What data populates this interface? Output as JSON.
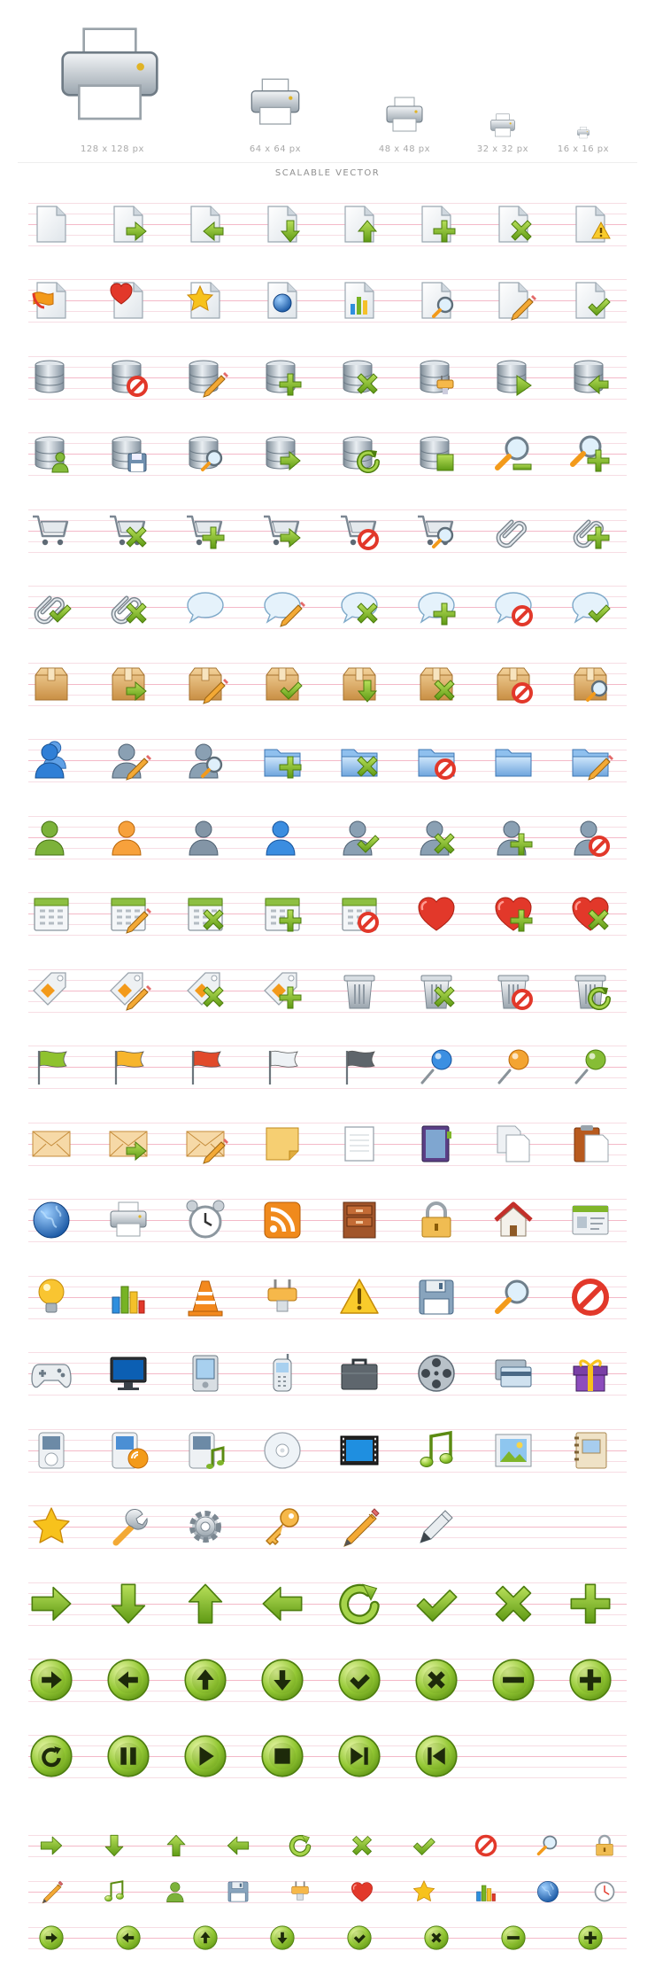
{
  "header": {
    "sizes": [
      "128 x 128 px",
      "64 x 64 px",
      "48 x 48 px",
      "32 x 32 px",
      "16 x 16 px"
    ],
    "title": "SCALABLE VECTOR"
  },
  "colors": {
    "green": "#77b324",
    "green_dark": "#4f7f10",
    "red": "#e23a2a",
    "orange": "#f39a1a",
    "blue": "#2d76c7",
    "gray": "#8c9aa6",
    "paper": "#eef1f4",
    "guide_line": "#f6c6d2"
  },
  "rows": [
    [
      "page",
      "page-arrow-right",
      "page-arrow-left",
      "page-arrow-down",
      "page-arrow-up",
      "page-add",
      "page-delete",
      "page-warning"
    ],
    [
      "page-bookmark",
      "page-heart",
      "page-star",
      "page-globe",
      "page-chart",
      "page-search",
      "page-edit",
      "page-check"
    ],
    [
      "database",
      "database-block",
      "database-edit",
      "database-add",
      "database-delete",
      "database-plug",
      "database-play",
      "database-import"
    ],
    [
      "database-user",
      "database-save",
      "database-search",
      "database-export",
      "database-refresh",
      "database-stop",
      "zoom-out",
      "zoom-in"
    ],
    [
      "cart",
      "cart-delete",
      "cart-add",
      "cart-go",
      "cart-block",
      "cart-search",
      "attach",
      "attach-add"
    ],
    [
      "attach-check",
      "attach-delete",
      "comment",
      "comment-edit",
      "comment-delete",
      "comment-add",
      "comment-block",
      "comment-check"
    ],
    [
      "box",
      "box-go",
      "box-edit",
      "box-check",
      "box-down",
      "box-delete",
      "box-block",
      "box-search"
    ],
    [
      "users",
      "user-edit",
      "user-search",
      "folder-add",
      "folder-delete",
      "folder-block",
      "folder",
      "folder-edit"
    ],
    [
      "user-green",
      "user-orange",
      "user-gray",
      "user-blue",
      "user-check",
      "user-delete",
      "user-add",
      "user-block"
    ],
    [
      "calendar",
      "calendar-edit",
      "calendar-delete",
      "calendar-add",
      "calendar-block",
      "heart",
      "heart-add",
      "heart-delete"
    ],
    [
      "tag",
      "tag-edit",
      "tag-delete",
      "tag-add",
      "trash",
      "trash-delete",
      "trash-block",
      "trash-refresh"
    ],
    [
      "flag-green",
      "flag-yellow",
      "flag-red",
      "flag-white",
      "flag-black",
      "pin-blue",
      "pin-orange",
      "pin-green"
    ],
    [
      "mail",
      "mail-go",
      "mail-edit",
      "note",
      "notepad",
      "book",
      "pages",
      "clipboard"
    ],
    [
      "globe",
      "printer",
      "alarm-clock",
      "rss",
      "cabinet",
      "lock",
      "home",
      "id-card"
    ],
    [
      "bulb",
      "chart",
      "cone",
      "plug",
      "warning",
      "disk",
      "search",
      "block"
    ],
    [
      "gamepad",
      "monitor",
      "pda",
      "phone",
      "briefcase",
      "film-reel",
      "credit-card",
      "gift"
    ],
    [
      "player",
      "player-sound",
      "player-music",
      "cd",
      "film",
      "music",
      "image",
      "photo-book"
    ],
    [
      "star",
      "wrench",
      "gear",
      "key",
      "pencil",
      "pen"
    ],
    [
      "arrow-right",
      "arrow-down",
      "arrow-up",
      "arrow-left",
      "refresh",
      "check",
      "cross",
      "plus"
    ],
    [
      "circle-arrow-right",
      "circle-arrow-left",
      "circle-arrow-up",
      "circle-arrow-down",
      "circle-check",
      "circle-cross",
      "circle-minus",
      "circle-plus"
    ],
    [
      "circle-refresh",
      "circle-pause",
      "circle-play",
      "circle-stop",
      "circle-next",
      "circle-previous"
    ]
  ],
  "small_rows": [
    [
      "arrow-right",
      "arrow-down",
      "arrow-up",
      "arrow-left",
      "refresh",
      "cross",
      "check",
      "block",
      "search",
      "lock"
    ],
    [
      "pencil",
      "music",
      "user-green",
      "disk",
      "plug",
      "heart",
      "star",
      "chart",
      "globe",
      "clock"
    ],
    [
      "circle-arrow-right",
      "circle-arrow-left",
      "circle-arrow-up",
      "circle-arrow-down",
      "circle-check",
      "circle-cross",
      "circle-minus",
      "circle-plus"
    ]
  ]
}
